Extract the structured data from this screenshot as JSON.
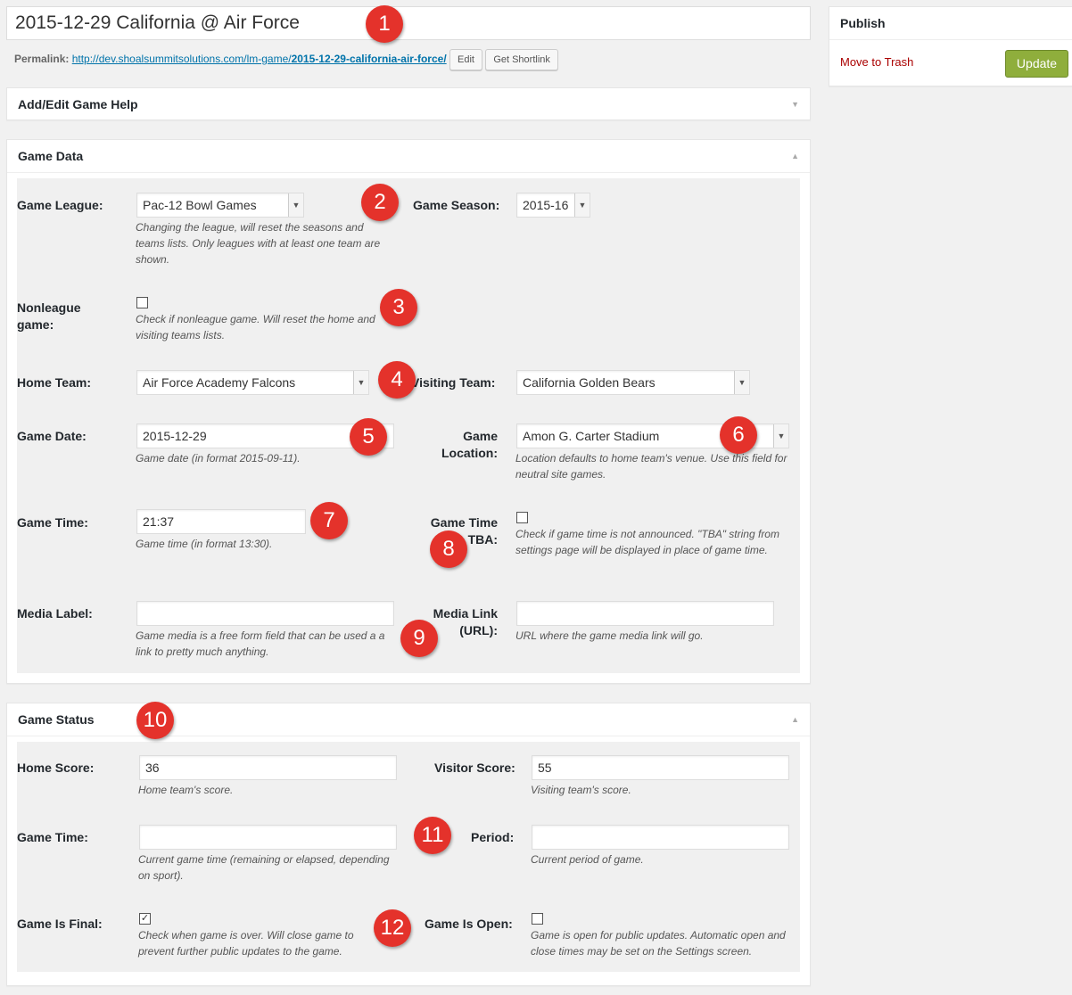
{
  "title": "2015-12-29 California @ Air Force",
  "permalink": {
    "label": "Permalink:",
    "base": "http://dev.shoalsummitsolutions.com/lm-game/",
    "slug": "2015-12-29-california-air-force/",
    "edit_label": "Edit",
    "shortlink_label": "Get Shortlink"
  },
  "help_panel": {
    "title": "Add/Edit Game Help"
  },
  "game_data": {
    "title": "Game Data",
    "league": {
      "label": "Game League:",
      "value": "Pac-12 Bowl Games",
      "desc": "Changing the league, will reset the seasons and teams lists. Only leagues with at least one team are shown."
    },
    "season": {
      "label": "Game Season:",
      "value": "2015-16"
    },
    "nonleague": {
      "label_line1": "Nonleague",
      "label_line2": "game:",
      "desc": "Check if nonleague game. Will reset the home and visiting teams lists."
    },
    "home_team": {
      "label": "Home Team:",
      "value": "Air Force Academy Falcons"
    },
    "visiting_team": {
      "label": "Visiting Team:",
      "value": "California Golden Bears"
    },
    "game_date": {
      "label": "Game Date:",
      "value": "2015-12-29",
      "desc": "Game date (in format 2015-09-11)."
    },
    "location": {
      "label_line1": "Game",
      "label_line2": "Location:",
      "value": "Amon G. Carter Stadium",
      "desc": "Location defaults to home team's venue. Use this field for neutral site games."
    },
    "game_time": {
      "label": "Game Time:",
      "value": "21:37",
      "desc": "Game time (in format 13:30)."
    },
    "time_tba": {
      "label_line1": "Game Time",
      "label_line2": "TBA:",
      "desc": "Check if game time is not announced. \"TBA\" string from settings page will be displayed in place of game time."
    },
    "media_label": {
      "label": "Media Label:",
      "value": "",
      "desc": "Game media is a free form field that can be used a a link to pretty much anything."
    },
    "media_link": {
      "label_line1": "Media Link",
      "label_line2": "(URL):",
      "value": "",
      "desc": "URL where the game media link will go."
    }
  },
  "game_status": {
    "title": "Game Status",
    "home_score": {
      "label": "Home Score:",
      "value": "36",
      "desc": "Home team's score."
    },
    "visitor_score": {
      "label": "Visitor Score:",
      "value": "55",
      "desc": "Visiting team's score."
    },
    "current_time": {
      "label": "Game Time:",
      "value": "",
      "desc": "Current game time (remaining or elapsed, depending on sport)."
    },
    "period": {
      "label": "Period:",
      "value": "",
      "desc": "Current period of game."
    },
    "is_final": {
      "label": "Game Is Final:",
      "checked": true,
      "check_glyph": "✓",
      "desc": "Check when game is over. Will close game to prevent further public updates to the game."
    },
    "is_open": {
      "label": "Game Is Open:",
      "checked": false,
      "desc": "Game is open for public updates. Automatic open and close times may be set on the Settings screen."
    }
  },
  "publish": {
    "title": "Publish",
    "trash_label": "Move to Trash",
    "update_label": "Update"
  },
  "markers": [
    "1",
    "2",
    "3",
    "4",
    "5",
    "6",
    "7",
    "8",
    "9",
    "10",
    "11",
    "12"
  ],
  "icons": {
    "collapse": "triangle-down-icon",
    "expand": "triangle-up-icon",
    "select": "chevron-down-icon"
  },
  "colors": {
    "marker": "#e4322b",
    "update_button": "#8fae3c",
    "link": "#0073aa",
    "trash": "#a00000"
  }
}
